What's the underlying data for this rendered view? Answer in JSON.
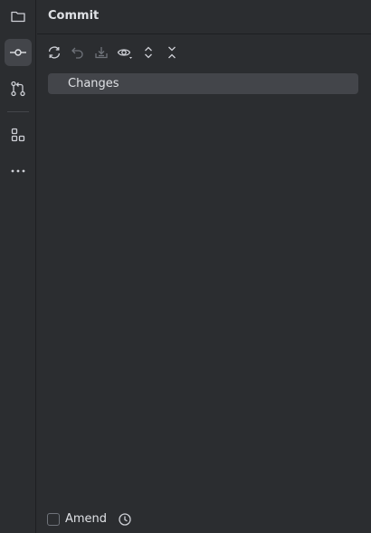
{
  "window": {
    "title": "Commit"
  },
  "toolStrip": {
    "items": [
      {
        "icon": "project-folder-icon",
        "active": false
      },
      {
        "icon": "commit-icon",
        "active": true
      },
      {
        "icon": "pull-requests-icon",
        "active": false
      },
      {
        "icon": "structure-icon",
        "active": false
      },
      {
        "icon": "more-icon",
        "active": false
      }
    ]
  },
  "toolbar": {
    "buttons": [
      {
        "icon": "refresh-icon",
        "enabled": true
      },
      {
        "icon": "rollback-icon",
        "enabled": false
      },
      {
        "icon": "shelve-icon",
        "enabled": false
      },
      {
        "icon": "view-options-icon",
        "enabled": true
      },
      {
        "icon": "expand-all-icon",
        "enabled": true
      },
      {
        "icon": "collapse-all-icon",
        "enabled": true
      }
    ]
  },
  "changes": {
    "groupLabel": "Changes"
  },
  "footer": {
    "amendLabel": "Amend",
    "amendChecked": false
  },
  "colors": {
    "background": "#2b2d30",
    "selection": "#43454a",
    "text": "#dfe1e5",
    "iconEnabled": "#ced0d6",
    "iconDisabled": "#6f737a"
  }
}
